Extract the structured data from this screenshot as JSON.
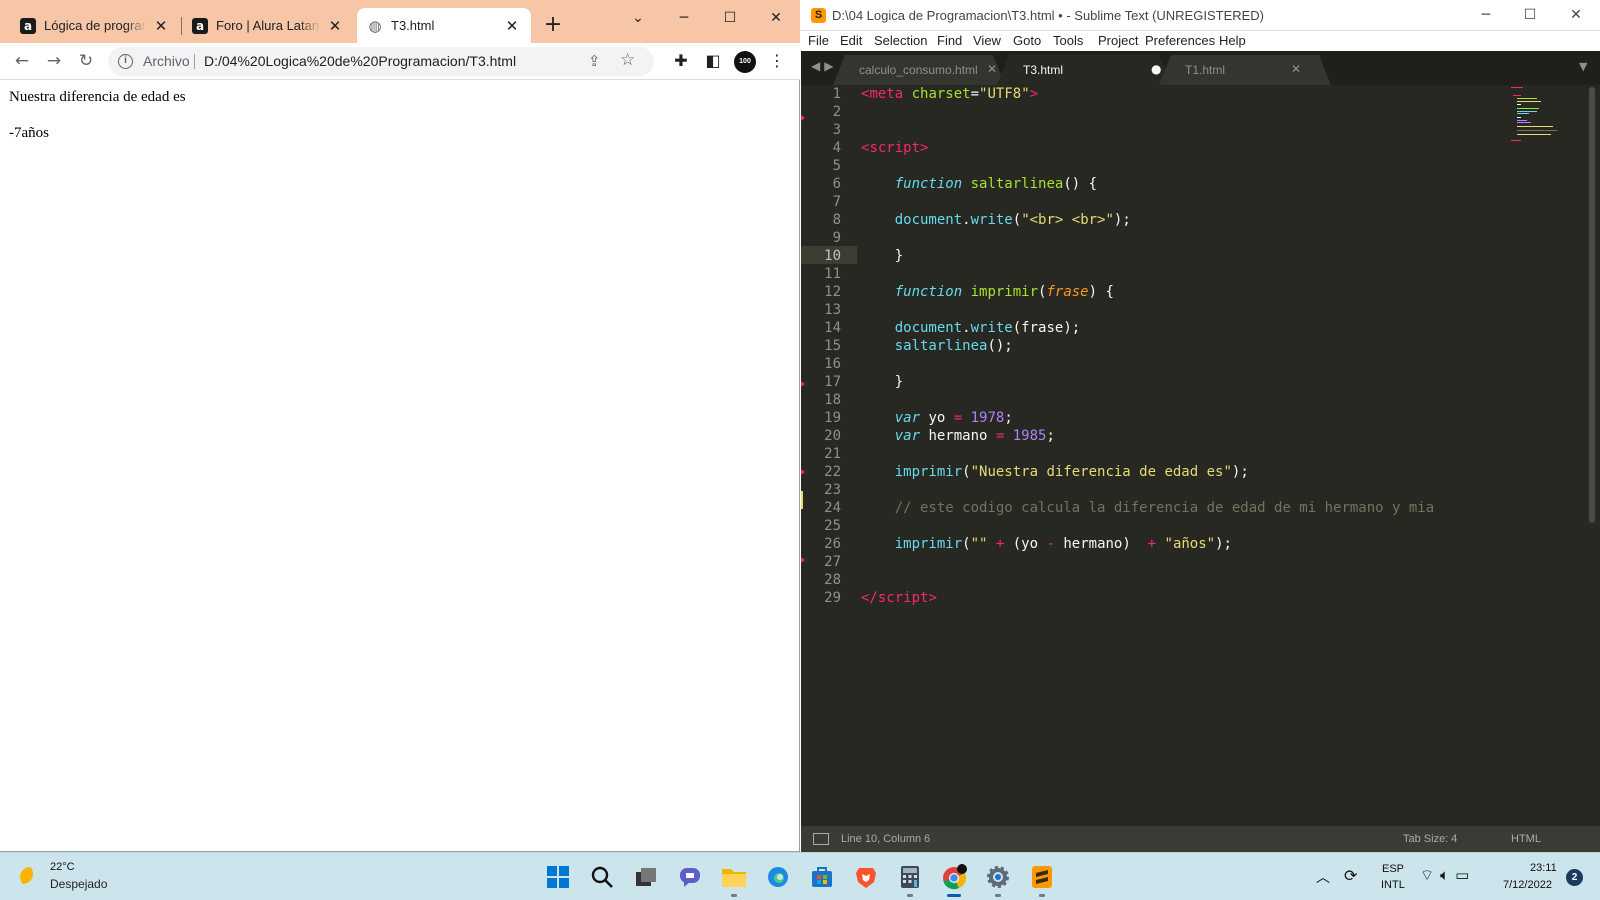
{
  "browser": {
    "tabs": [
      {
        "label": "Lógica de programación",
        "favicon": "alura-icon"
      },
      {
        "label": "Foro | Alura Latam - Cursos",
        "favicon": "alura-icon"
      },
      {
        "label": "T3.html",
        "favicon": "globe-icon"
      }
    ],
    "favicon_glyph": "a",
    "address_scheme": "Archivo",
    "address_url": "D:/04%20Logica%20de%20Programacion/T3.html",
    "profile_label": "100",
    "page_lines": [
      "Nuestra diferencia de edad es",
      "-7años"
    ]
  },
  "sublime": {
    "title": "D:\\04 Logica de Programacion\\T3.html • - Sublime Text (UNREGISTERED)",
    "app_icon_glyph": "S",
    "menu": [
      "File",
      "Edit",
      "Selection",
      "Find",
      "View",
      "Goto",
      "Tools",
      "Project",
      "Preferences",
      "Help"
    ],
    "tabs": [
      {
        "label": "calculo_consumo.html",
        "state": "close"
      },
      {
        "label": "T3.html",
        "state": "modified"
      },
      {
        "label": "T1.html",
        "state": "close"
      }
    ],
    "line_numbers": [
      "1",
      "2",
      "3",
      "4",
      "5",
      "6",
      "7",
      "8",
      "9",
      "10",
      "11",
      "12",
      "13",
      "14",
      "15",
      "16",
      "17",
      "18",
      "19",
      "20",
      "21",
      "22",
      "23",
      "24",
      "25",
      "26",
      "27",
      "28",
      "29"
    ],
    "current_line": 10,
    "code": [
      [
        [
          "tag",
          "<"
        ],
        [
          "tagname",
          "meta"
        ],
        [
          "pl",
          " "
        ],
        [
          "attr",
          "charset"
        ],
        [
          "pl",
          "="
        ],
        [
          "str",
          "\"UTF8\""
        ],
        [
          "tag",
          ">"
        ]
      ],
      [],
      [],
      [
        [
          "tag",
          "<"
        ],
        [
          "tagname",
          "script"
        ],
        [
          "tag",
          ">"
        ]
      ],
      [],
      [
        [
          "pl",
          "    "
        ],
        [
          "kw",
          "function"
        ],
        [
          "pl",
          " "
        ],
        [
          "fn",
          "saltarlinea"
        ],
        [
          "pl",
          "() {"
        ]
      ],
      [],
      [
        [
          "pl",
          "    "
        ],
        [
          "sup",
          "document"
        ],
        [
          "pl",
          "."
        ],
        [
          "sup",
          "write"
        ],
        [
          "pl",
          "("
        ],
        [
          "str",
          "\"<br> <br>\""
        ],
        [
          "pl",
          ");"
        ]
      ],
      [],
      [
        [
          "pl",
          "    }"
        ]
      ],
      [],
      [
        [
          "pl",
          "    "
        ],
        [
          "kw",
          "function"
        ],
        [
          "pl",
          " "
        ],
        [
          "fn",
          "imprimir"
        ],
        [
          "pl",
          "("
        ],
        [
          "param",
          "frase"
        ],
        [
          "pl",
          ") {"
        ]
      ],
      [],
      [
        [
          "pl",
          "    "
        ],
        [
          "sup",
          "document"
        ],
        [
          "pl",
          "."
        ],
        [
          "sup",
          "write"
        ],
        [
          "pl",
          "(frase);"
        ]
      ],
      [
        [
          "pl",
          "    "
        ],
        [
          "sup",
          "saltarlinea"
        ],
        [
          "pl",
          "();"
        ]
      ],
      [],
      [
        [
          "pl",
          "    }"
        ]
      ],
      [],
      [
        [
          "pl",
          "    "
        ],
        [
          "kw",
          "var"
        ],
        [
          "pl",
          " yo "
        ],
        [
          "op",
          "="
        ],
        [
          "pl",
          " "
        ],
        [
          "num",
          "1978"
        ],
        [
          "pl",
          ";"
        ]
      ],
      [
        [
          "pl",
          "    "
        ],
        [
          "kw",
          "var"
        ],
        [
          "pl",
          " hermano "
        ],
        [
          "op",
          "="
        ],
        [
          "pl",
          " "
        ],
        [
          "num",
          "1985"
        ],
        [
          "pl",
          ";"
        ]
      ],
      [],
      [
        [
          "pl",
          "    "
        ],
        [
          "sup",
          "imprimir"
        ],
        [
          "pl",
          "("
        ],
        [
          "str",
          "\"Nuestra diferencia de edad es\""
        ],
        [
          "pl",
          ");"
        ]
      ],
      [],
      [
        [
          "pl",
          "    "
        ],
        [
          "com",
          "// este codigo calcula la diferencia de edad de mi hermano y mia"
        ]
      ],
      [],
      [
        [
          "pl",
          "    "
        ],
        [
          "sup",
          "imprimir"
        ],
        [
          "pl",
          "("
        ],
        [
          "str",
          "\"\""
        ],
        [
          "pl",
          " "
        ],
        [
          "op",
          "+"
        ],
        [
          "pl",
          " (yo "
        ],
        [
          "op",
          "-"
        ],
        [
          "pl",
          " hermano)  "
        ],
        [
          "op",
          "+"
        ],
        [
          "pl",
          " "
        ],
        [
          "str",
          "\"años\""
        ],
        [
          "pl",
          ");"
        ]
      ],
      [],
      [],
      [
        [
          "tag",
          "</"
        ],
        [
          "tagname",
          "script"
        ],
        [
          "tag",
          ">"
        ]
      ]
    ],
    "status_position": "Line 10, Column 6",
    "status_tabsize": "Tab Size: 4",
    "status_syntax": "HTML"
  },
  "taskbar": {
    "weather_temp": "22°C",
    "weather_desc": "Despejado",
    "lang_line1": "ESP",
    "lang_line2": "INTL",
    "time": "23:11",
    "date": "7/12/2022",
    "notification_count": "2"
  },
  "colors": {
    "chrome_tabbar": "#f6c6a6",
    "editor_bg": "#272822",
    "taskbar_bg": "#cce4ec"
  }
}
